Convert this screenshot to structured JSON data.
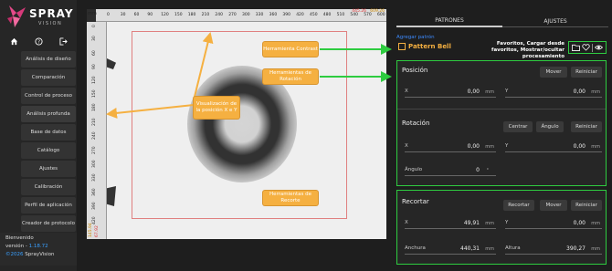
{
  "app": {
    "logo_text": "SPRAY",
    "logo_sub": "VISION"
  },
  "sidebar": {
    "icons": [
      "home-icon",
      "help-icon",
      "logout-icon"
    ],
    "items": [
      {
        "label": "Análisis de diseño"
      },
      {
        "label": "Comparación"
      },
      {
        "label": "Control de proceso"
      },
      {
        "label": "Análisis profunda"
      },
      {
        "label": "Base de datos"
      },
      {
        "label": "Catálogo"
      },
      {
        "label": "Ajustes"
      },
      {
        "label": "Calibración"
      },
      {
        "label": "Perfil de aplicación"
      },
      {
        "label": "Creador de protocolo"
      }
    ],
    "welcome": "Bienvenido",
    "version_label": "versión - ",
    "version": "1.18.72",
    "copyright": "©2026",
    "copyright_name": "SprayVision"
  },
  "viewer": {
    "unit": "mm",
    "x_ticks": [
      "0",
      "30",
      "60",
      "90",
      "120",
      "150",
      "180",
      "210",
      "240",
      "270",
      "300",
      "330",
      "360",
      "390",
      "420",
      "450",
      "480",
      "510",
      "540",
      "570",
      "600"
    ],
    "y_ticks": [
      "0",
      "30",
      "60",
      "90",
      "120",
      "150",
      "180",
      "210",
      "240",
      "270",
      "300",
      "330",
      "360",
      "390",
      "420"
    ],
    "readout_x": "445.26",
    "readout_y": "609.26",
    "readout_left_1": "145.94",
    "readout_left_2": "67.92"
  },
  "annotations": {
    "contrast": "Herramienta Contrast",
    "rotation": "Herramientas de Rotación",
    "xy_view": "Visualización de la posición X e Y",
    "crop": "Herramientas de Recorte",
    "favorites": "Favoritos, Cargar desde favoritos, Mostrar/ocultar procesamiento"
  },
  "panel": {
    "tabs": [
      {
        "label": "PATRONES"
      },
      {
        "label": "AJUSTES"
      }
    ],
    "add_pattern": "Agregar patrón",
    "pattern_name": "Pattern Bell",
    "position": {
      "title": "Posición",
      "buttons": [
        "Mover",
        "Reiniciar"
      ],
      "x_label": "X",
      "x_value": "0,00",
      "x_unit": "mm",
      "y_label": "Y",
      "y_value": "0,00",
      "y_unit": "mm"
    },
    "rotation": {
      "title": "Rotación",
      "buttons": [
        "Centrar",
        "Ángulo",
        "Reiniciar"
      ],
      "x_label": "X",
      "x_value": "0,00",
      "x_unit": "mm",
      "y_label": "Y",
      "y_value": "0,00",
      "y_unit": "mm",
      "angle_label": "Ángulo",
      "angle_value": "0",
      "angle_unit": "°"
    },
    "crop": {
      "title": "Recortar",
      "buttons": [
        "Recortar",
        "Mover",
        "Reiniciar"
      ],
      "x_label": "X",
      "x_value": "49,91",
      "x_unit": "mm",
      "y_label": "Y",
      "y_value": "0,00",
      "y_unit": "mm",
      "width_label": "Anchura",
      "width_value": "440,31",
      "width_unit": "mm",
      "height_label": "Altura",
      "height_value": "390,27",
      "height_unit": "mm"
    }
  },
  "colors": {
    "accent_green": "#2ecc40",
    "annotation_orange": "#f5b041",
    "link_blue": "#3d8bff"
  }
}
